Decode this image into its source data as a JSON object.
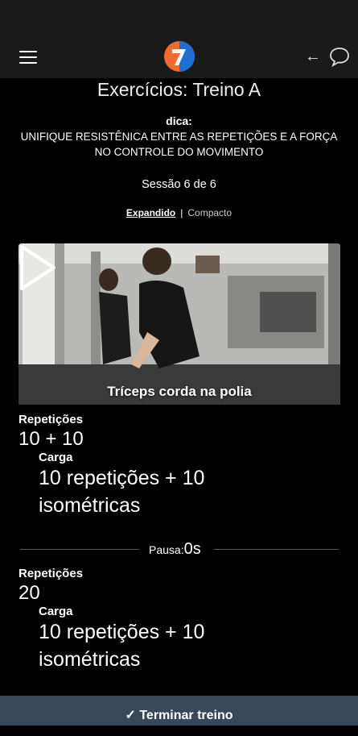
{
  "header": {
    "menu_icon": "hamburger-menu-icon",
    "logo_icon": "app-logo-7",
    "back_icon": "arrow-left-icon",
    "chat_icon": "chat-bubble-icon"
  },
  "title": "Exercícios: Treino A",
  "tip": {
    "label": "dica:",
    "text": "UNIFIQUE RESISTÊNICA ENTRE AS REPETIÇÕES E A FORÇA NO CONTROLE DO MOVIMENTO"
  },
  "session": "Sessão 6 de 6",
  "view": {
    "expanded": "Expandido",
    "separator": "|",
    "compact": "Compacto"
  },
  "exercise": {
    "name": "Tríceps corda na polia",
    "play_icon": "play-icon",
    "sets": [
      {
        "reps_label": "Repetições",
        "reps_value": "10 + 10",
        "load_label": "Carga",
        "load_value": "10 repetições + 10 isométricas"
      },
      {
        "reps_label": "Repetições",
        "reps_value": "20",
        "load_label": "Carga",
        "load_value": "10 repetições + 10 isométricas"
      }
    ],
    "pause_label": "Pausa:",
    "pause_value": "0s"
  },
  "footer": {
    "finish_label": "✓ Terminar treino"
  },
  "colors": {
    "background": "#000000",
    "appbar": "#1a1a1a",
    "bottom_bar": "#37485a",
    "logo_orange": "#f26a2e",
    "logo_blue": "#1d6fd1"
  }
}
